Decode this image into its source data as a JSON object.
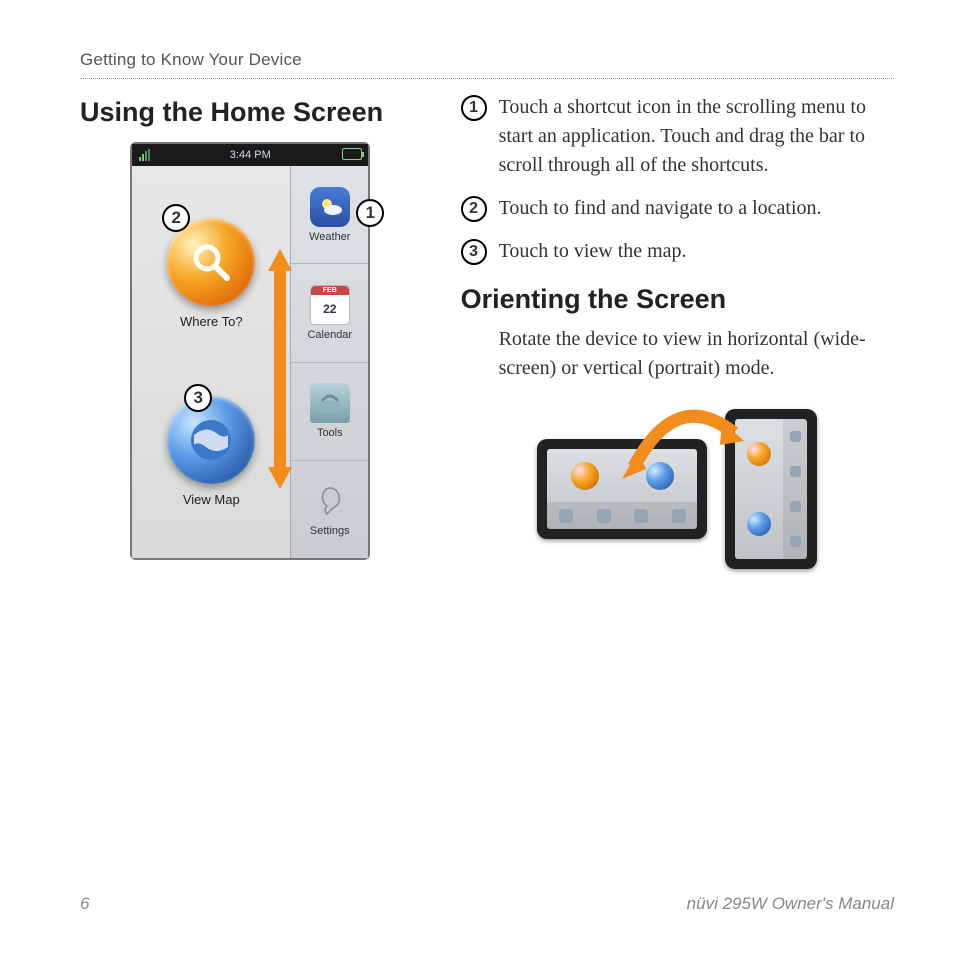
{
  "header": {
    "section": "Getting to Know Your Device"
  },
  "left": {
    "heading": "Using the Home Screen",
    "status_time": "3:44 PM",
    "main_apps": {
      "where": "Where To?",
      "map": "View Map"
    },
    "side_apps": {
      "weather": "Weather",
      "calendar": "Calendar",
      "calendar_day": "22",
      "tools": "Tools",
      "settings": "Settings"
    },
    "callouts": {
      "c1": "1",
      "c2": "2",
      "c3": "3"
    }
  },
  "right": {
    "steps": {
      "s1_num": "1",
      "s1": "Touch a shortcut icon in the scrolling menu to start an application. Touch and drag the bar to scroll through all of the shortcuts.",
      "s2_num": "2",
      "s2": "Touch to find and navigate to a location.",
      "s3_num": "3",
      "s3": "Touch to view the map."
    },
    "heading2": "Orienting the Screen",
    "body2": "Rotate the device to view in horizontal (wide-screen) or vertical (portrait) mode."
  },
  "footer": {
    "page": "6",
    "title": "nüvi 295W Owner's Manual"
  }
}
